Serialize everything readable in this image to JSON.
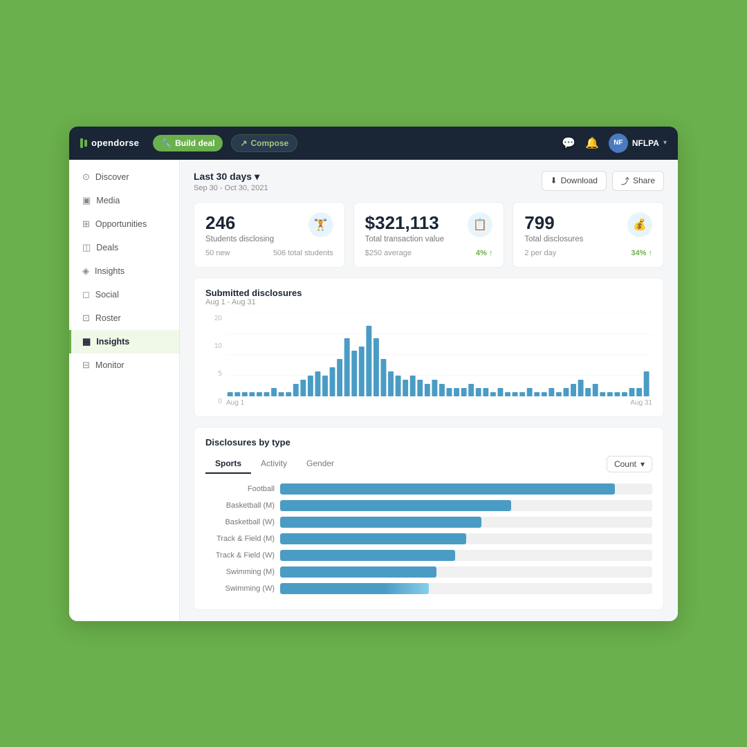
{
  "nav": {
    "logo_text": "opendorse",
    "build_deal_label": "Build deal",
    "compose_label": "Compose",
    "profile_name": "NFLPA",
    "profile_initials": "NF"
  },
  "sidebar": {
    "items": [
      {
        "label": "Discover",
        "icon": "🔍",
        "active": false
      },
      {
        "label": "Media",
        "icon": "🖼",
        "active": false
      },
      {
        "label": "Opportunities",
        "icon": "⊞",
        "active": false
      },
      {
        "label": "Deals",
        "icon": "🤝",
        "active": false
      },
      {
        "label": "Insights",
        "icon": "📊",
        "active": false
      },
      {
        "label": "Social",
        "icon": "💬",
        "active": false
      },
      {
        "label": "Roster",
        "icon": "👥",
        "active": false
      },
      {
        "label": "Insights",
        "icon": "📈",
        "active": true
      },
      {
        "label": "Monitor",
        "icon": "🖥",
        "active": false
      }
    ]
  },
  "content": {
    "date_range_label": "Last 30 days",
    "date_range_sub": "Sep 30 - Oct 30, 2021",
    "download_label": "Download",
    "share_label": "Share",
    "stats": [
      {
        "value": "246",
        "label": "Students disclosing",
        "sub1": "50 new",
        "sub2": "506 total students",
        "badge": "",
        "icon": "🏋"
      },
      {
        "value": "$321,113",
        "label": "Total transaction value",
        "sub1": "$250 average",
        "sub2": "",
        "badge": "4% ↑",
        "icon": "📋"
      },
      {
        "value": "799",
        "label": "Total disclosures",
        "sub1": "2 per day",
        "sub2": "",
        "badge": "34% ↑",
        "icon": "💰"
      }
    ],
    "submitted_chart": {
      "title": "Submitted disclosures",
      "subtitle": "Aug 1 - Aug 31",
      "y_labels": [
        "20",
        "10",
        "5",
        "0"
      ],
      "x_labels": [
        "Aug 1",
        "Aug 31"
      ],
      "bars": [
        1,
        1,
        1,
        1,
        1,
        1,
        2,
        1,
        1,
        3,
        4,
        5,
        6,
        5,
        7,
        9,
        14,
        11,
        12,
        17,
        14,
        9,
        6,
        5,
        4,
        5,
        4,
        3,
        4,
        3,
        2,
        2,
        2,
        3,
        2,
        2,
        1,
        2,
        1,
        1,
        1,
        2,
        1,
        2,
        3,
        4,
        2,
        3,
        1,
        1,
        1,
        1,
        2,
        2,
        1,
        2,
        1,
        6
      ]
    },
    "disclosures_by_type": {
      "title": "Disclosures by type",
      "tabs": [
        "Sports",
        "Activity",
        "Gender"
      ],
      "active_tab": "Sports",
      "count_label": "Count",
      "sports": [
        {
          "label": "Football",
          "pct": 90
        },
        {
          "label": "Basketball (M)",
          "pct": 62
        },
        {
          "label": "Basketball (W)",
          "pct": 54
        },
        {
          "label": "Track & Field (M)",
          "pct": 50
        },
        {
          "label": "Track & Field (W)",
          "pct": 47
        },
        {
          "label": "Swimming (M)",
          "pct": 42
        },
        {
          "label": "Swimming (W)",
          "pct": 40
        }
      ]
    }
  }
}
